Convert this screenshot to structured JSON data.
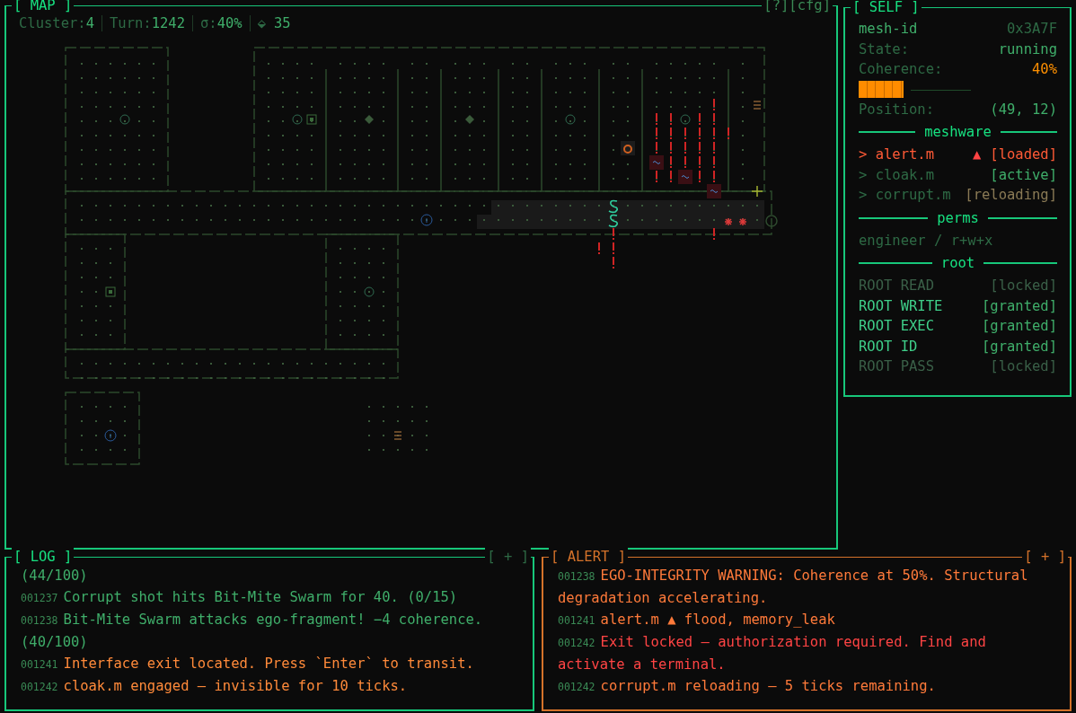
{
  "map": {
    "title": "[ MAP ]",
    "controls": [
      "[?]",
      "[cfg]"
    ],
    "stats": [
      {
        "label": "Cluster:",
        "value": "4"
      },
      {
        "label": "Turn:",
        "value": "1242"
      },
      {
        "label": "σ:",
        "value": "40%"
      },
      {
        "label": "⬙",
        "value": "35"
      }
    ]
  },
  "self": {
    "title": "[ SELF ]",
    "fields": [
      {
        "label": "mesh-id",
        "value": "0x3A7F",
        "color": "#2e6a45"
      },
      {
        "label": "State:",
        "value": "running",
        "color": "#3fae6a"
      },
      {
        "label": "Coherence:",
        "value": "40%",
        "color": "#ff9000"
      }
    ],
    "coherence": {
      "level": 0.4
    },
    "position": {
      "label": "Position:",
      "value": "(49, 12)"
    },
    "meshware": {
      "title": "meshware",
      "items": [
        {
          "name": "> alert.m",
          "flag": "▲",
          "status": "[loaded]",
          "color": "#ff5a36"
        },
        {
          "name": "> cloak.m",
          "status": "[active]",
          "color": "#3fae6a"
        },
        {
          "name": "> corrupt.m",
          "status": "[reloading]",
          "color": "#8a7a55"
        }
      ]
    },
    "perms": {
      "title": "perms",
      "text": "engineer / r+w+x"
    },
    "root": {
      "title": "root",
      "items": [
        {
          "name": "ROOT READ",
          "status": "[locked]",
          "locked": true
        },
        {
          "name": "ROOT WRITE",
          "status": "[granted]",
          "locked": false
        },
        {
          "name": "ROOT EXEC",
          "status": "[granted]",
          "locked": false
        },
        {
          "name": "ROOT ID",
          "status": "[granted]",
          "locked": false
        },
        {
          "name": "ROOT PASS",
          "status": "[locked]",
          "locked": true
        }
      ]
    }
  },
  "log": {
    "title": "[ LOG ]",
    "control": "[ + ]",
    "entries": [
      {
        "text": "(44/100)",
        "color": "#3fae6a"
      },
      {
        "id": "001237",
        "text": "Corrupt shot hits Bit-Mite Swarm for 40. (0/15)",
        "color": "#3fae6a"
      },
      {
        "id": "001238",
        "text": "Bit-Mite Swarm attacks ego-fragment! −4 coherence. (40/100)",
        "color": "#3fae6a"
      },
      {
        "id": "001241",
        "text": "Interface exit located. Press `Enter` to transit.",
        "color": "#ff8a3a"
      },
      {
        "id": "001242",
        "text": "cloak.m engaged — invisible for 10 ticks.",
        "color": "#ff8a3a"
      }
    ]
  },
  "alert": {
    "title": "[ ALERT ]",
    "control": "[ + ]",
    "entries": [
      {
        "id": "001238",
        "text": "EGO-INTEGRITY WARNING: Coherence at 50%. Structural degradation accelerating.",
        "color": "#ff7a3a"
      },
      {
        "id": "001241",
        "text": "alert.m ▲ flood, memory_leak",
        "color": "#ff7a3a"
      },
      {
        "id": "001242",
        "text": "Exit locked — authorization required. Find and activate a terminal.",
        "color": "#ff4444"
      },
      {
        "id": "001242",
        "text": "corrupt.m reloading — 5 ticks remaining.",
        "color": "#ff7a3a"
      }
    ]
  }
}
